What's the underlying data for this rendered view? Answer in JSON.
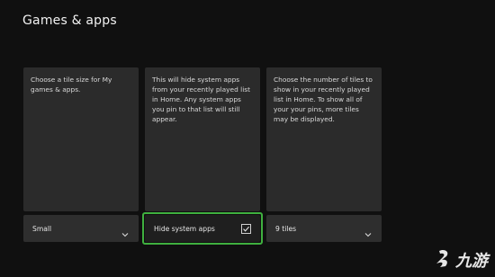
{
  "page": {
    "title": "Games & apps"
  },
  "cards": [
    {
      "description": "Choose a tile size for My games & apps."
    },
    {
      "description": "This will hide system apps from your recently played list in Home. Any system apps you pin to that list will still appear."
    },
    {
      "description": "Choose the number of tiles to show in your recently played list in Home. To show all of your your pins, more tiles may be displayed."
    }
  ],
  "controls": {
    "tile_size": {
      "value": "Small",
      "icon": "chevron-down-icon"
    },
    "hide_system_apps": {
      "label": "Hide system apps",
      "checked": true,
      "icon": "checkbox-checked-icon"
    },
    "tile_count": {
      "value": "9 tiles",
      "icon": "chevron-down-icon"
    }
  },
  "watermark": {
    "text": "九游",
    "icon": "nine-game-logo-icon"
  },
  "colors": {
    "background": "#101010",
    "card": "#2b2b2b",
    "focus": "#3fb03f"
  }
}
